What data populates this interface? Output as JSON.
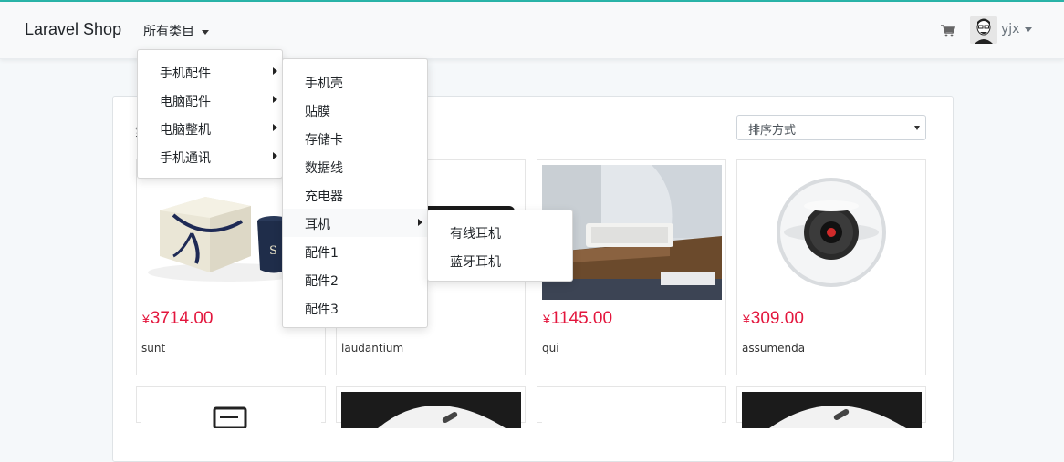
{
  "navbar": {
    "brand": "Laravel Shop",
    "categories_toggle": "所有类目",
    "cart_icon": "shopping-cart-icon",
    "user_name": "yjx"
  },
  "filters": {
    "search_label_partial": "第",
    "sort_placeholder": "排序方式"
  },
  "menu_level1": [
    {
      "label": "手机配件"
    },
    {
      "label": "电脑配件"
    },
    {
      "label": "电脑整机"
    },
    {
      "label": "手机通讯"
    }
  ],
  "menu_level2": [
    {
      "label": "手机壳"
    },
    {
      "label": "贴膜"
    },
    {
      "label": "存储卡"
    },
    {
      "label": "数据线"
    },
    {
      "label": "充电器"
    },
    {
      "label": "耳机"
    },
    {
      "label": "配件1"
    },
    {
      "label": "配件2"
    },
    {
      "label": "配件3"
    }
  ],
  "menu_level3": [
    {
      "label": "有线耳机"
    },
    {
      "label": "蓝牙耳机"
    }
  ],
  "products": [
    {
      "currency": "¥",
      "price": "3714.00",
      "title": "sunt"
    },
    {
      "currency": "¥",
      "price": "",
      "title": "laudantium"
    },
    {
      "currency": "¥",
      "price": "1145.00",
      "title": "qui"
    },
    {
      "currency": "¥",
      "price": "309.00",
      "title": "assumenda"
    }
  ],
  "colors": {
    "price": "#e3163d",
    "accent_line": "#2ab4a8"
  }
}
